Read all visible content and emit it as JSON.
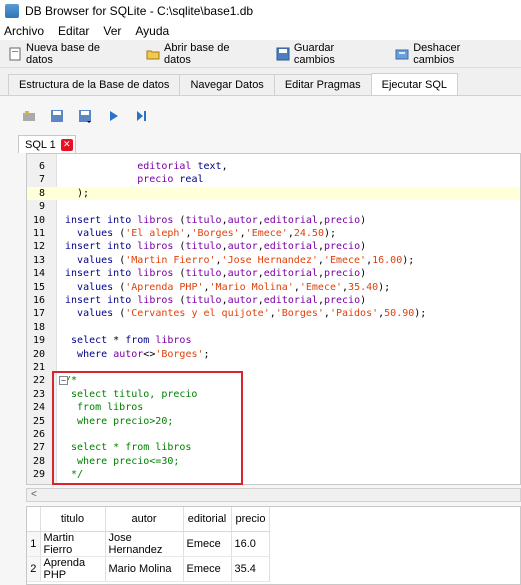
{
  "window": {
    "title": "DB Browser for SQLite - C:\\sqlite\\base1.db"
  },
  "menu": [
    "Archivo",
    "Editar",
    "Ver",
    "Ayuda"
  ],
  "toolbar": {
    "new_db": "Nueva base de datos",
    "open_db": "Abrir base de datos",
    "save": "Guardar cambios",
    "undo": "Deshacer cambios"
  },
  "tabs": [
    "Estructura de la Base de datos",
    "Navegar Datos",
    "Editar Pragmas",
    "Ejecutar SQL"
  ],
  "active_tab": "Ejecutar SQL",
  "sql_tab": "SQL 1",
  "editor_lines": [
    {
      "n": "6",
      "code": "            editorial text,"
    },
    {
      "n": "7",
      "code": "            precio real"
    },
    {
      "n": "8",
      "code": "  );"
    },
    {
      "n": "9",
      "code": ""
    },
    {
      "n": "10",
      "code": "insert into libros (titulo,autor,editorial,precio)"
    },
    {
      "n": "11",
      "code": "  values ('El aleph','Borges','Emece',24.50);"
    },
    {
      "n": "12",
      "code": "insert into libros (titulo,autor,editorial,precio)"
    },
    {
      "n": "13",
      "code": "  values ('Martin Fierro','Jose Hernandez','Emece',16.00);"
    },
    {
      "n": "14",
      "code": "insert into libros (titulo,autor,editorial,precio)"
    },
    {
      "n": "15",
      "code": "  values ('Aprenda PHP','Mario Molina','Emece',35.40);"
    },
    {
      "n": "16",
      "code": "insert into libros (titulo,autor,editorial,precio)"
    },
    {
      "n": "17",
      "code": "  values ('Cervantes y el quijote','Borges','Paidos',50.90);"
    },
    {
      "n": "18",
      "code": ""
    },
    {
      "n": "19",
      "code": " select * from libros"
    },
    {
      "n": "20",
      "code": "  where autor<>'Borges';"
    },
    {
      "n": "21",
      "code": ""
    },
    {
      "n": "22",
      "code": "/*"
    },
    {
      "n": "23",
      "code": " select titulo, precio"
    },
    {
      "n": "24",
      "code": "  from libros"
    },
    {
      "n": "25",
      "code": "  where precio>20;"
    },
    {
      "n": "26",
      "code": ""
    },
    {
      "n": "27",
      "code": " select * from libros"
    },
    {
      "n": "28",
      "code": "  where precio<=30;"
    },
    {
      "n": "29",
      "code": " */"
    }
  ],
  "results": {
    "columns": [
      "titulo",
      "autor",
      "editorial",
      "precio"
    ],
    "rows": [
      {
        "n": "1",
        "cells": [
          "Martin Fierro",
          "Jose Hernandez",
          "Emece",
          "16.0"
        ]
      },
      {
        "n": "2",
        "cells": [
          "Aprenda PHP",
          "Mario Molina",
          "Emece",
          "35.4"
        ]
      }
    ]
  }
}
